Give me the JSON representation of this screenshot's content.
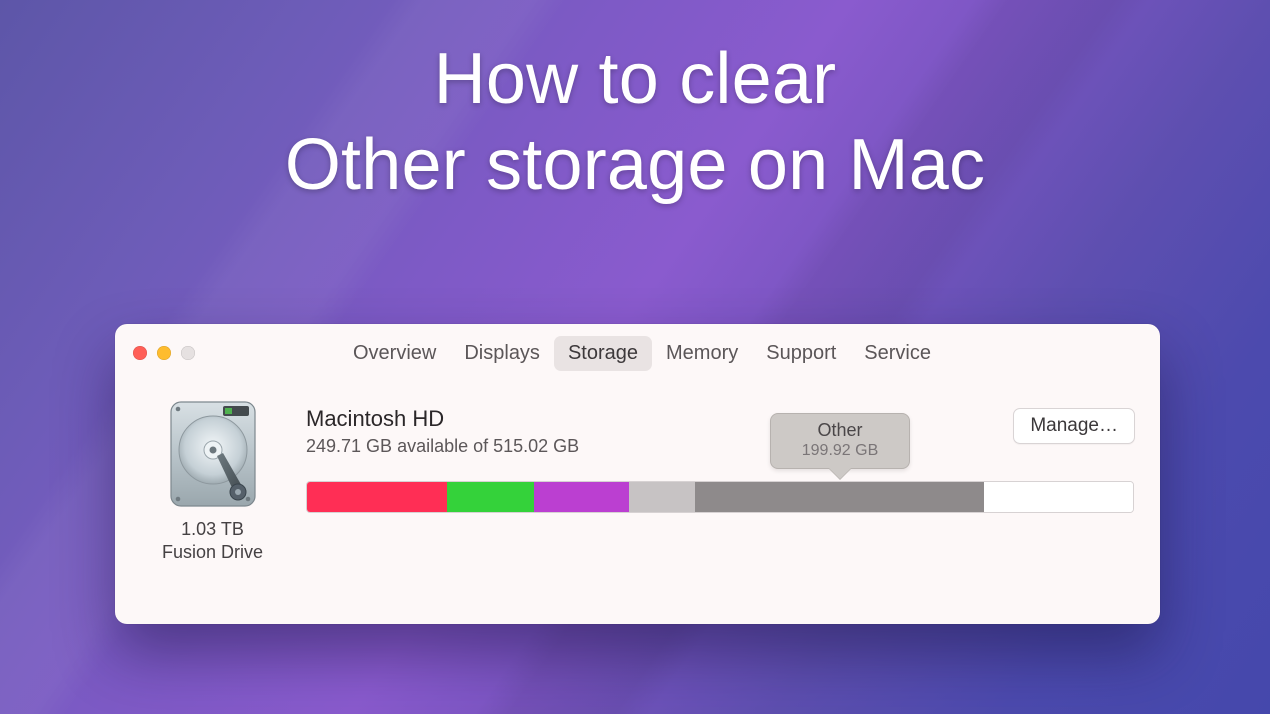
{
  "headline": {
    "line1": "How to clear",
    "line2": "Other storage on Mac"
  },
  "tabs": [
    {
      "label": "Overview",
      "active": false
    },
    {
      "label": "Displays",
      "active": false
    },
    {
      "label": "Storage",
      "active": true
    },
    {
      "label": "Memory",
      "active": false
    },
    {
      "label": "Support",
      "active": false
    },
    {
      "label": "Service",
      "active": false
    }
  ],
  "drive": {
    "caption_line1": "1.03 TB",
    "caption_line2": "Fusion Drive",
    "name": "Macintosh HD",
    "subtitle": "249.71 GB available of 515.02 GB"
  },
  "storage_bar": {
    "segments": [
      {
        "name": "red",
        "color": "#ff2e55",
        "flex": 17
      },
      {
        "name": "green",
        "color": "#34d23a",
        "flex": 10.5
      },
      {
        "name": "purple",
        "color": "#bb3fd1",
        "flex": 11.5
      },
      {
        "name": "light",
        "color": "#c7c3c4",
        "flex": 8
      },
      {
        "name": "other",
        "color": "#8e8a8b",
        "flex": 35
      },
      {
        "name": "free",
        "color": "#ffffff",
        "flex": 18
      }
    ]
  },
  "callout": {
    "title": "Other",
    "subtitle": "199.92 GB"
  },
  "manage_button": "Manage…"
}
